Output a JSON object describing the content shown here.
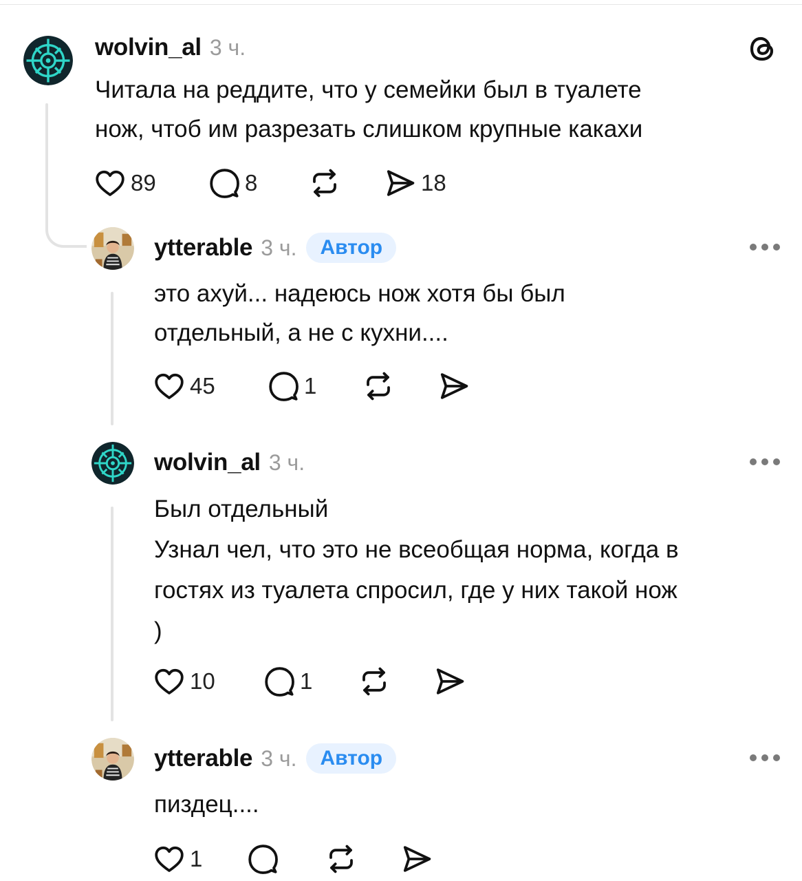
{
  "posts": [
    {
      "username": "wolvin_al",
      "time": "3 ч.",
      "lines": [
        "Читала на реддите, что у семейки был в туалете",
        "нож, чтоб им разрезать слишком крупные какахи"
      ],
      "likes": "89",
      "replies": "8",
      "shares": "18"
    },
    {
      "username": "ytterable",
      "time": "3 ч.",
      "badge": "Автор",
      "lines": [
        "это ахуй... надеюсь нож хотя бы был",
        "отдельный, а не с кухни...."
      ],
      "likes": "45",
      "replies": "1"
    },
    {
      "username": "wolvin_al",
      "time": "3 ч.",
      "lines": [
        "Был отдельный",
        "Узнал чел, что это не всеобщая норма, когда в",
        "гостях из туалета спросил, где у них такой нож",
        ")"
      ],
      "likes": "10",
      "replies": "1"
    },
    {
      "username": "ytterable",
      "time": "3 ч.",
      "badge": "Автор",
      "lines": [
        "пиздец...."
      ],
      "likes": "1"
    }
  ],
  "icons": {
    "app_logo": "threads-logo-icon",
    "like": "heart-icon",
    "reply": "comment-icon",
    "repost": "repost-icon",
    "share": "send-icon",
    "more": "more-dots-icon"
  },
  "colors": {
    "avatar_bg": "#10262c",
    "avatar_accent": "#2fd6c8",
    "badge_bg": "#e8f2ff",
    "badge_text": "#2a8cf0"
  }
}
